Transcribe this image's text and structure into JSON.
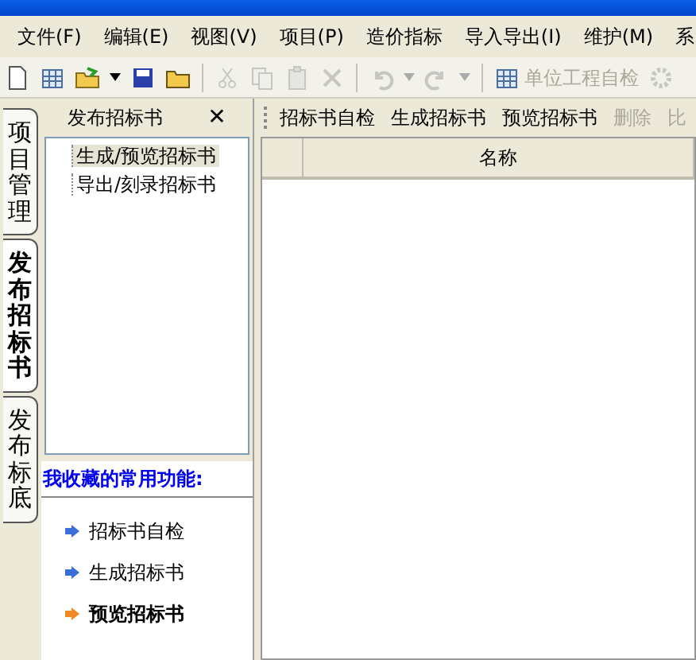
{
  "menu": [
    "文件(F)",
    "编辑(E)",
    "视图(V)",
    "项目(P)",
    "造价指标",
    "导入导出(I)",
    "维护(M)",
    "系"
  ],
  "toolbar": [
    {
      "kind": "icon",
      "disabled": false
    },
    {
      "kind": "icon",
      "disabled": false
    },
    {
      "kind": "icon",
      "disabled": false
    },
    {
      "kind": "caret",
      "disabled": false
    },
    {
      "kind": "icon",
      "disabled": false
    },
    {
      "kind": "icon",
      "disabled": false
    },
    {
      "kind": "sep"
    },
    {
      "kind": "icon",
      "disabled": true
    },
    {
      "kind": "icon",
      "disabled": true
    },
    {
      "kind": "icon",
      "disabled": true
    },
    {
      "kind": "icon",
      "disabled": true
    },
    {
      "kind": "sep"
    },
    {
      "kind": "icon",
      "disabled": true
    },
    {
      "kind": "caret",
      "disabled": true
    },
    {
      "kind": "icon",
      "disabled": true
    },
    {
      "kind": "caret",
      "disabled": true
    },
    {
      "kind": "sep"
    },
    {
      "kind": "text",
      "label": "单位工程自检",
      "disabled": true
    },
    {
      "kind": "icon",
      "disabled": true
    }
  ],
  "side_tabs": [
    {
      "label": "项目管理",
      "selected": false
    },
    {
      "label": "发布招标书",
      "selected": true
    },
    {
      "label": "发布标底",
      "selected": false
    }
  ],
  "panel": {
    "title": "发布招标书",
    "close": "✕",
    "tree": [
      {
        "label": "生成/预览招标书",
        "selected": true
      },
      {
        "label": "导出/刻录招标书",
        "selected": false
      }
    ],
    "favorites_title": "我收藏的常用功能:",
    "favorites": [
      {
        "label": "招标书自检",
        "selected": false
      },
      {
        "label": "生成招标书",
        "selected": false
      },
      {
        "label": "预览招标书",
        "selected": true
      }
    ]
  },
  "actions": [
    {
      "label": "招标书自检",
      "disabled": false
    },
    {
      "label": "生成招标书",
      "disabled": false
    },
    {
      "label": "预览招标书",
      "disabled": false
    },
    {
      "label": "删除",
      "disabled": true
    },
    {
      "label": "比",
      "disabled": true
    }
  ],
  "table": {
    "columns": [
      "",
      "名称"
    ]
  }
}
